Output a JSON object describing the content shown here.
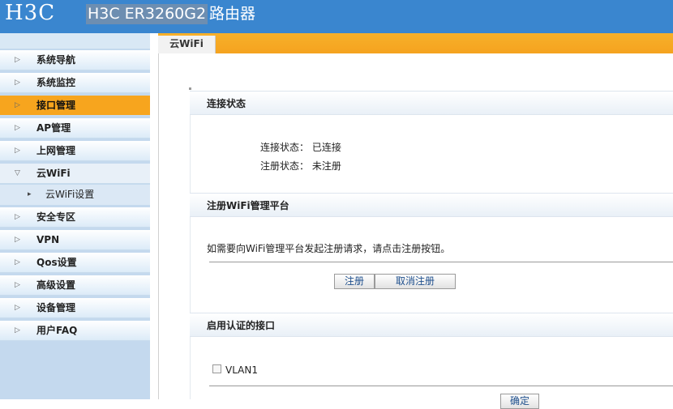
{
  "header": {
    "logo": "H3C",
    "model": "H3C ER3260G2",
    "subtitle": "路由器"
  },
  "sidebar": {
    "items": [
      {
        "label": "系统导航",
        "arrow": "▷"
      },
      {
        "label": "系统监控",
        "arrow": "▷"
      },
      {
        "label": "接口管理",
        "arrow": "▷"
      },
      {
        "label": "AP管理",
        "arrow": "▷"
      },
      {
        "label": "上网管理",
        "arrow": "▷"
      },
      {
        "label": "云WiFi",
        "arrow": "▽"
      },
      {
        "label": "安全专区",
        "arrow": "▷"
      },
      {
        "label": "VPN",
        "arrow": "▷"
      },
      {
        "label": "Qos设置",
        "arrow": "▷"
      },
      {
        "label": "高级设置",
        "arrow": "▷"
      },
      {
        "label": "设备管理",
        "arrow": "▷"
      },
      {
        "label": "用户FAQ",
        "arrow": "▷"
      }
    ],
    "sub_item": {
      "label": "云WiFi设置",
      "arrow": "▸"
    }
  },
  "tab": {
    "label": "云WiFi"
  },
  "connection": {
    "title": "连接状态",
    "conn_label": "连接状态：",
    "conn_value": "已连接",
    "reg_label": "注册状态：",
    "reg_value": "未注册"
  },
  "register": {
    "title": "注册WiFi管理平台",
    "description": "如需要向WiFi管理平台发起注册请求，请点击注册按钮。",
    "register_button": "注册",
    "cancel_button": "取消注册"
  },
  "auth": {
    "title": "启用认证的接口",
    "interface": "VLAN1",
    "confirm_button": "确定"
  },
  "colors": {
    "header": "#3a86cf",
    "accent": "#f7a51e",
    "sidebar": "#c4d9ee"
  }
}
